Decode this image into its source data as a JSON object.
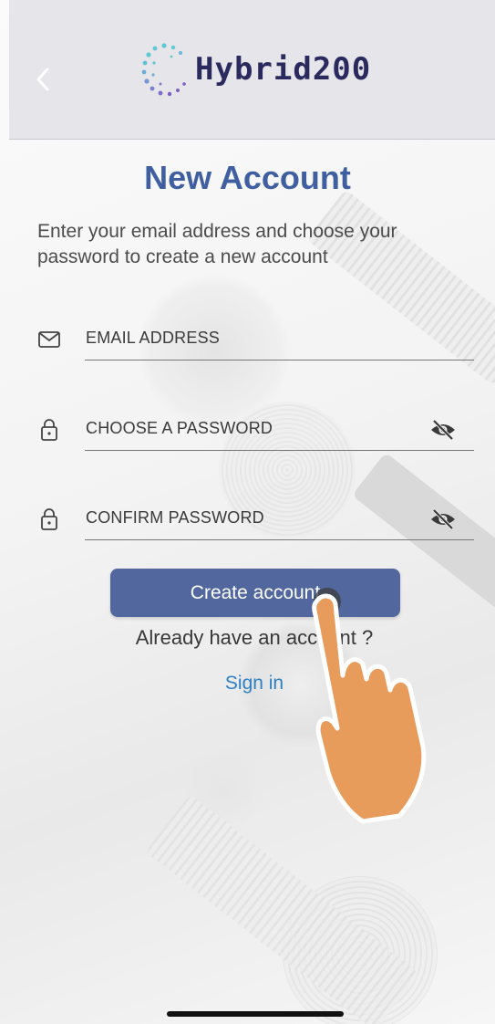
{
  "header": {
    "back_icon": "chevron-left-icon",
    "logo_text": "Hybrid200",
    "colors": {
      "background": "#e6e5ea",
      "logo_text": "#2b2a5e",
      "logo_dots": [
        "#5ec9d3",
        "#7b5fc4"
      ]
    }
  },
  "page": {
    "title": "New Account",
    "subtitle": "Enter your email address and choose your password to create a new account"
  },
  "form": {
    "email": {
      "placeholder": "EMAIL ADDRESS",
      "icon": "mail-icon"
    },
    "password": {
      "placeholder": "CHOOSE A PASSWORD",
      "icon": "lock-icon",
      "toggle_icon": "eye-off-icon"
    },
    "confirm": {
      "placeholder": "CONFIRM PASSWORD",
      "icon": "lock-icon",
      "toggle_icon": "eye-off-icon"
    }
  },
  "actions": {
    "create_label": "Create account",
    "already_text": "Already have an account ?",
    "signin_label": "Sign in"
  },
  "colors": {
    "title": "#3f5fa1",
    "button": "#52679e",
    "link": "#2d7fc6"
  }
}
